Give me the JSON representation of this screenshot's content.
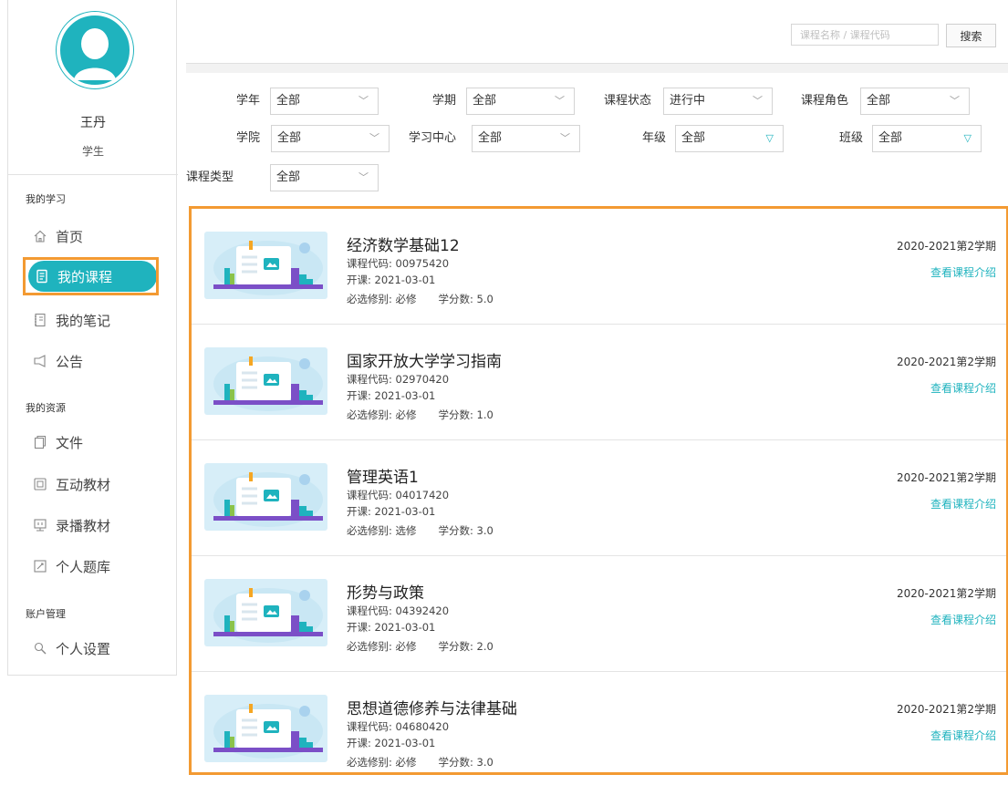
{
  "user": {
    "name": "王丹",
    "role": "学生"
  },
  "sidebar": {
    "sections": [
      {
        "label": "我的学习"
      },
      {
        "label": "我的资源"
      },
      {
        "label": "账户管理"
      }
    ],
    "items": [
      {
        "label": "首页",
        "icon": "home-icon"
      },
      {
        "label": "我的课程",
        "icon": "course-icon",
        "active": true
      },
      {
        "label": "我的笔记",
        "icon": "notebook-icon"
      },
      {
        "label": "公告",
        "icon": "announcement-icon"
      },
      {
        "label": "文件",
        "icon": "file-icon"
      },
      {
        "label": "互动教材",
        "icon": "interactive-book-icon"
      },
      {
        "label": "录播教材",
        "icon": "video-book-icon"
      },
      {
        "label": "个人题库",
        "icon": "question-bank-icon"
      },
      {
        "label": "个人设置",
        "icon": "settings-icon"
      }
    ]
  },
  "search": {
    "placeholder": "课程名称 / 课程代码",
    "button": "搜索"
  },
  "filters": [
    {
      "label": "学年",
      "value": "全部"
    },
    {
      "label": "学期",
      "value": "全部"
    },
    {
      "label": "课程状态",
      "value": "进行中"
    },
    {
      "label": "课程角色",
      "value": "全部"
    },
    {
      "label": "学院",
      "value": "全部"
    },
    {
      "label": "学习中心",
      "value": "全部"
    },
    {
      "label": "年级",
      "value": "全部"
    },
    {
      "label": "班级",
      "value": "全部"
    },
    {
      "label": "课程类型",
      "value": "全部"
    }
  ],
  "courses": [
    {
      "title": "经济数学基础12",
      "code": "课程代码: 00975420",
      "start": "开课: 2021-03-01",
      "type": "必选修别: 必修",
      "credits": "学分数: 5.0",
      "term": "2020-2021第2学期",
      "link": "查看课程介绍"
    },
    {
      "title": "国家开放大学学习指南",
      "code": "课程代码: 02970420",
      "start": "开课: 2021-03-01",
      "type": "必选修别: 必修",
      "credits": "学分数: 1.0",
      "term": "2020-2021第2学期",
      "link": "查看课程介绍"
    },
    {
      "title": "管理英语1",
      "code": "课程代码: 04017420",
      "start": "开课: 2021-03-01",
      "type": "必选修别: 选修",
      "credits": "学分数: 3.0",
      "term": "2020-2021第2学期",
      "link": "查看课程介绍"
    },
    {
      "title": "形势与政策",
      "code": "课程代码: 04392420",
      "start": "开课: 2021-03-01",
      "type": "必选修别: 必修",
      "credits": "学分数: 2.0",
      "term": "2020-2021第2学期",
      "link": "查看课程介绍"
    },
    {
      "title": "思想道德修养与法律基础",
      "code": "课程代码: 04680420",
      "start": "开课: 2021-03-01",
      "type": "必选修别: 必修",
      "credits": "学分数: 3.0",
      "term": "2020-2021第2学期",
      "link": "查看课程介绍"
    }
  ],
  "colors": {
    "accent": "#1fb3be",
    "highlight": "#f39a32"
  }
}
